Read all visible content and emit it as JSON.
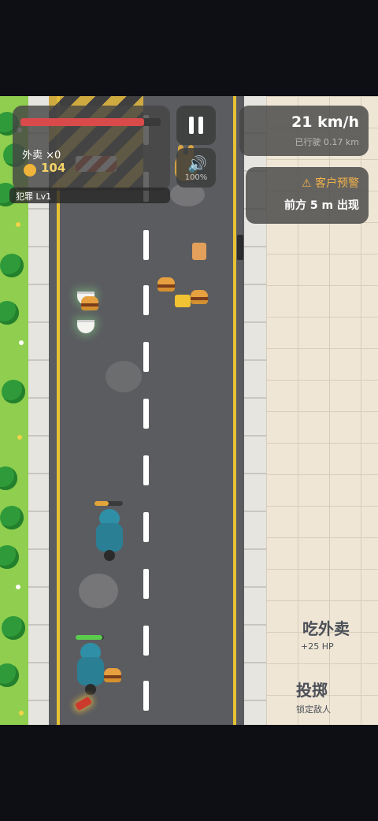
{
  "hud": {
    "delivery_label": "外卖 ×0",
    "coins": "104",
    "crime_level": "犯罪 Lv1",
    "volume": "100%",
    "speed": "21 km/h",
    "distance": "已行驶 0.17 km",
    "warning_title": "客户预警",
    "warning_text": "前方 5 m 出现",
    "health_fraction": 0.88
  },
  "actions": {
    "eat_label": "吃外卖",
    "eat_sub": "+25 HP",
    "throw_label": "投掷",
    "throw_sub": "锁定敌人"
  },
  "colors": {
    "health": "#d94a4a",
    "road": "#5b5c60",
    "lane_yellow": "#e7c235",
    "grass": "#8fce4e",
    "rider": "#2a7f95"
  },
  "icons": [
    "coin-icon",
    "pause-icon",
    "speaker-icon",
    "warning-icon",
    "burger-icon",
    "bag-icon",
    "bowl-icon",
    "rabbit-icon",
    "firecracker-icon",
    "rider-icon"
  ]
}
